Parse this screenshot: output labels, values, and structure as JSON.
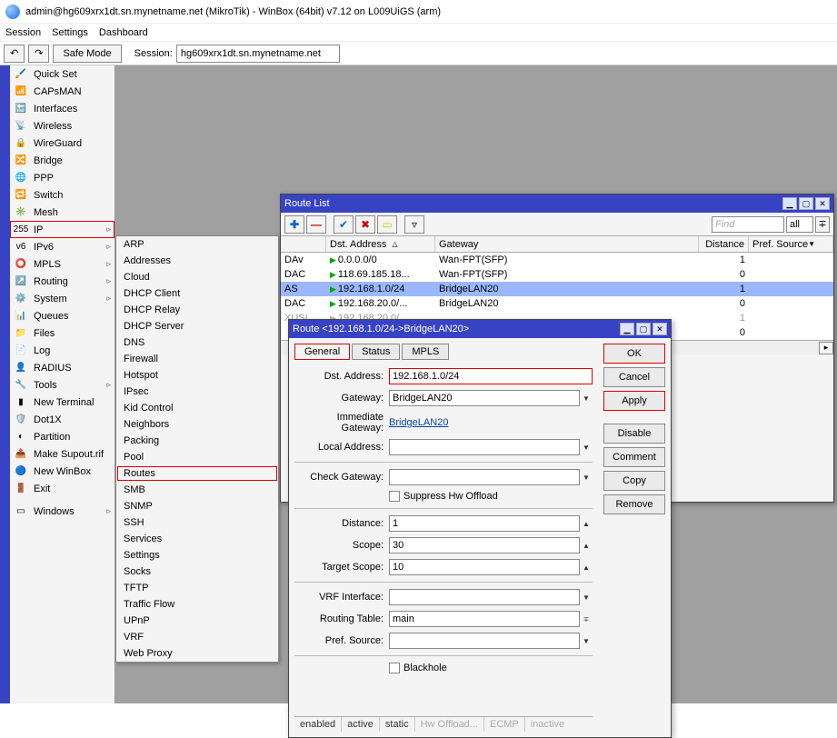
{
  "window": {
    "title": "admin@hg609xrx1dt.sn.mynetname.net (MikroTik) - WinBox (64bit) v7.12 on L009UiGS (arm)"
  },
  "menubar": {
    "items": [
      "Session",
      "Settings",
      "Dashboard"
    ]
  },
  "toolbar": {
    "undo": "↶",
    "redo": "↷",
    "safe_mode": "Safe Mode",
    "session_label": "Session:",
    "session_value": "hg609xrx1dt.sn.mynetname.net"
  },
  "sidebar": {
    "items": [
      {
        "icon": "🖌️",
        "label": "Quick Set"
      },
      {
        "icon": "📶",
        "label": "CAPsMAN"
      },
      {
        "icon": "🔚",
        "label": "Interfaces"
      },
      {
        "icon": "📡",
        "label": "Wireless"
      },
      {
        "icon": "🔒",
        "label": "WireGuard"
      },
      {
        "icon": "🔀",
        "label": "Bridge"
      },
      {
        "icon": "🌐",
        "label": "PPP"
      },
      {
        "icon": "🔁",
        "label": "Switch"
      },
      {
        "icon": "✳️",
        "label": "Mesh"
      },
      {
        "icon": "255",
        "label": "IP",
        "sub": true,
        "boxed": true
      },
      {
        "icon": "v6",
        "label": "IPv6",
        "sub": true
      },
      {
        "icon": "⭕",
        "label": "MPLS",
        "sub": true
      },
      {
        "icon": "↗️",
        "label": "Routing",
        "sub": true
      },
      {
        "icon": "⚙️",
        "label": "System",
        "sub": true
      },
      {
        "icon": "📊",
        "label": "Queues"
      },
      {
        "icon": "📁",
        "label": "Files"
      },
      {
        "icon": "📄",
        "label": "Log"
      },
      {
        "icon": "👤",
        "label": "RADIUS"
      },
      {
        "icon": "🔧",
        "label": "Tools",
        "sub": true
      },
      {
        "icon": "▮",
        "label": "New Terminal"
      },
      {
        "icon": "🛡️",
        "label": "Dot1X"
      },
      {
        "icon": "◐",
        "label": "Partition"
      },
      {
        "icon": "📤",
        "label": "Make Supout.rif"
      },
      {
        "icon": "🔵",
        "label": "New WinBox"
      },
      {
        "icon": "🚪",
        "label": "Exit"
      }
    ],
    "windows": {
      "icon": "▭",
      "label": "Windows"
    }
  },
  "submenu": {
    "items": [
      "ARP",
      "Addresses",
      "Cloud",
      "DHCP Client",
      "DHCP Relay",
      "DHCP Server",
      "DNS",
      "Firewall",
      "Hotspot",
      "IPsec",
      "Kid Control",
      "Neighbors",
      "Packing",
      "Pool",
      "Routes",
      "SMB",
      "SNMP",
      "SSH",
      "Services",
      "Settings",
      "Socks",
      "TFTP",
      "Traffic Flow",
      "UPnP",
      "VRF",
      "Web Proxy"
    ],
    "boxed": "Routes"
  },
  "routelist": {
    "title": "Route List",
    "find_placeholder": "Find",
    "filter_all": "all",
    "columns": [
      "",
      "Dst. Address",
      "Gateway",
      "Distance",
      "Pref. Source"
    ],
    "sort_arrow": "▼",
    "rows": [
      {
        "flag": "DAv",
        "dst": "0.0.0.0/0",
        "gw": "Wan-FPT(SFP)",
        "dist": "1",
        "sel": false
      },
      {
        "flag": "DAC",
        "dst": "118.69.185.18...",
        "gw": "Wan-FPT(SFP)",
        "dist": "0",
        "sel": false
      },
      {
        "flag": "AS",
        "dst": "192.168.1.0/24",
        "gw": "BridgeLAN20",
        "dist": "1",
        "sel": true
      },
      {
        "flag": "DAC",
        "dst": "192.168.20.0/...",
        "gw": "BridgeLAN20",
        "dist": "0",
        "sel": false
      },
      {
        "flag": "XUSI",
        "dst": "192.168.20.0/...",
        "gw": "",
        "dist": "1",
        "sel": false,
        "dim": true
      },
      {
        "flag": "",
        "dst": "",
        "gw": "",
        "dist": "0",
        "sel": false
      }
    ]
  },
  "routedlg": {
    "title": "Route <192.168.1.0/24->BridgeLAN20>",
    "tabs": [
      "General",
      "Status",
      "MPLS"
    ],
    "active_tab": "General",
    "labels": {
      "dst": "Dst. Address:",
      "gw": "Gateway:",
      "imm": "Immediate Gateway:",
      "local": "Local Address:",
      "chk": "Check Gateway:",
      "supp": "Suppress Hw Offload",
      "dist": "Distance:",
      "scope": "Scope:",
      "tscope": "Target Scope:",
      "vrf": "VRF Interface:",
      "rtable": "Routing Table:",
      "pref": "Pref. Source:",
      "black": "Blackhole"
    },
    "values": {
      "dst": "192.168.1.0/24",
      "gw": "BridgeLAN20",
      "imm": "BridgeLAN20",
      "local": "",
      "dist": "1",
      "scope": "30",
      "tscope": "10",
      "rtable": "main",
      "pref": ""
    },
    "status": [
      "enabled",
      "active",
      "static",
      "Hw Offload...",
      "ECMP",
      "inactive"
    ],
    "buttons": {
      "ok": "OK",
      "cancel": "Cancel",
      "apply": "Apply",
      "disable": "Disable",
      "comment": "Comment",
      "copy": "Copy",
      "remove": "Remove"
    }
  }
}
